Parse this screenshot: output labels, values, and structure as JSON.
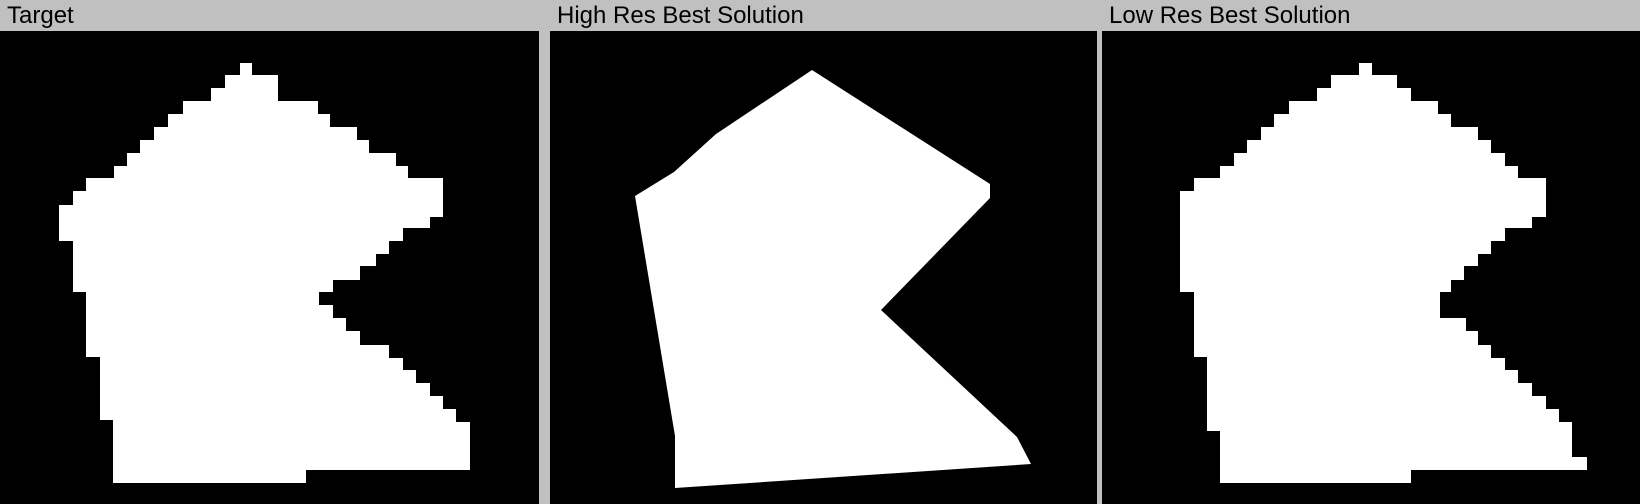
{
  "panels": {
    "target": {
      "title": "Target"
    },
    "high_res": {
      "title": "High Res Best Solution"
    },
    "low_res": {
      "title": "Low Res Best Solution"
    }
  },
  "colors": {
    "header_bg": "#c0c0c0",
    "canvas_bg": "#000000",
    "shape_fill": "#ffffff",
    "title_text": "#000000"
  }
}
